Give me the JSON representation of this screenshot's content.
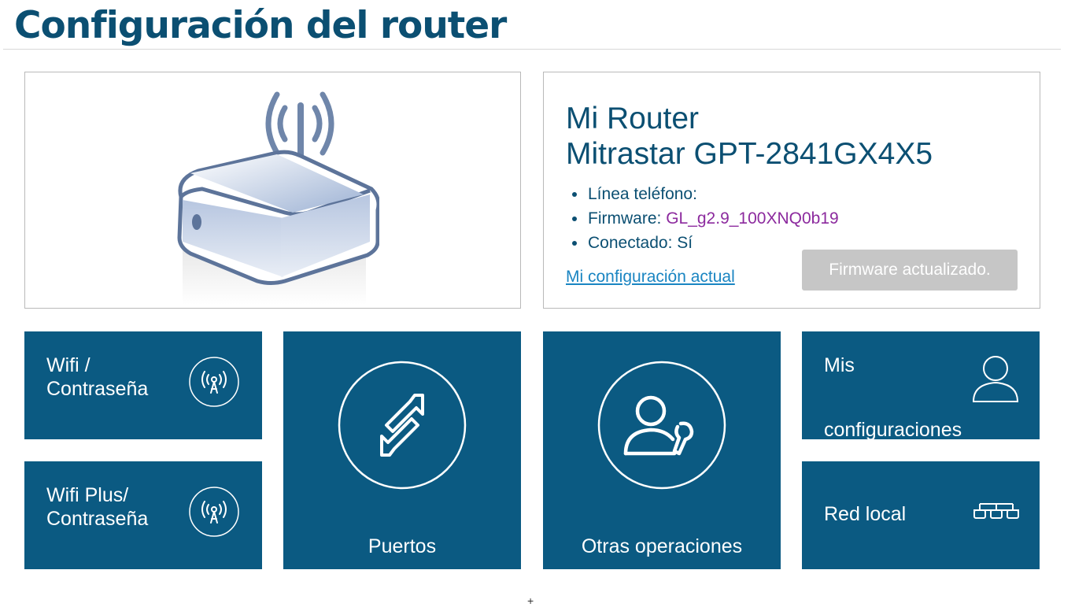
{
  "header": {
    "title": "Configuración del router"
  },
  "router": {
    "name_line1": "Mi Router",
    "name_line2": "Mitrastar GPT-2841GX4X5",
    "info": {
      "phone_label": "Línea teléfono:",
      "firmware_label": "Firmware:",
      "firmware_value": "GL_g2.9_100XNQ0b19",
      "connected_label": "Conectado: Sí"
    },
    "config_link": "Mi configuración actual",
    "firmware_button": "Firmware actualizado."
  },
  "tiles": {
    "wifi": {
      "line1": "Wifi /",
      "line2": "Contraseña",
      "icon": "wifi-antenna-icon"
    },
    "wifiplus": {
      "line1": "Wifi Plus/",
      "line2": "Contraseña",
      "icon": "wifi-antenna-icon"
    },
    "puertos": {
      "label": "Puertos",
      "icon": "ports-arrows-icon"
    },
    "otras": {
      "label": "Otras operaciones",
      "icon": "user-wrench-icon"
    },
    "misconf": {
      "line1": "Mis",
      "line2": "configuraciones",
      "icon": "user-icon"
    },
    "red": {
      "label": "Red local",
      "icon": "network-icon"
    }
  },
  "colors": {
    "brand": "#0b4f72",
    "tile_bg": "#0b5a82",
    "link": "#1a85c2",
    "firmware_value": "#8c2a9e",
    "button_disabled": "#c6c6c6"
  }
}
